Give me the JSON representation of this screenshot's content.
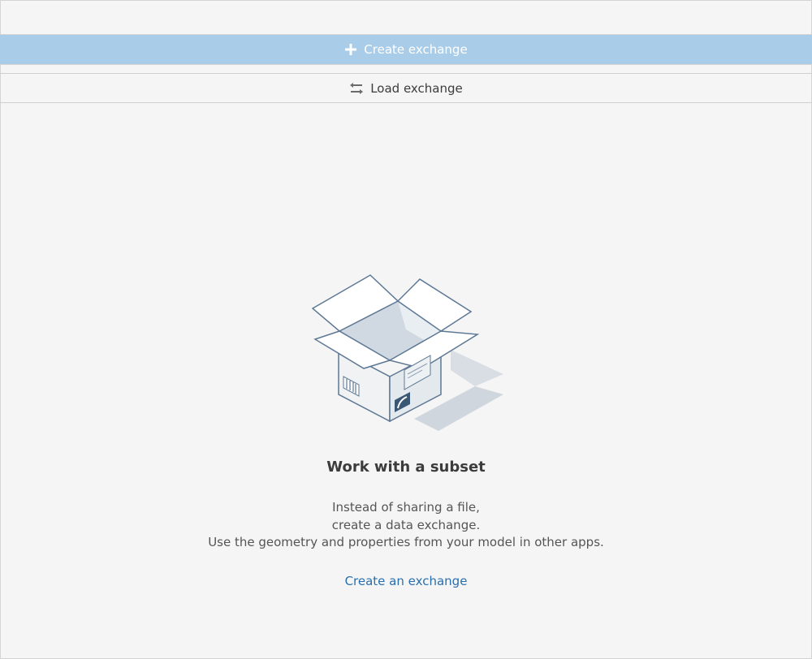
{
  "toolbar": {
    "create_label": "Create exchange",
    "create_icon": "plus-icon",
    "load_label": "Load exchange",
    "load_icon": "swap-arrows-icon"
  },
  "empty_state": {
    "illustration": "open-box-illustration",
    "title": "Work with a subset",
    "description": [
      "Instead of sharing a file,",
      "create a data exchange.",
      "Use the geometry and properties from your model in other apps."
    ],
    "link_label": "Create an exchange"
  },
  "colors": {
    "accent": "#a9cde8",
    "link": "#2a6fad",
    "background": "#f5f5f5"
  }
}
